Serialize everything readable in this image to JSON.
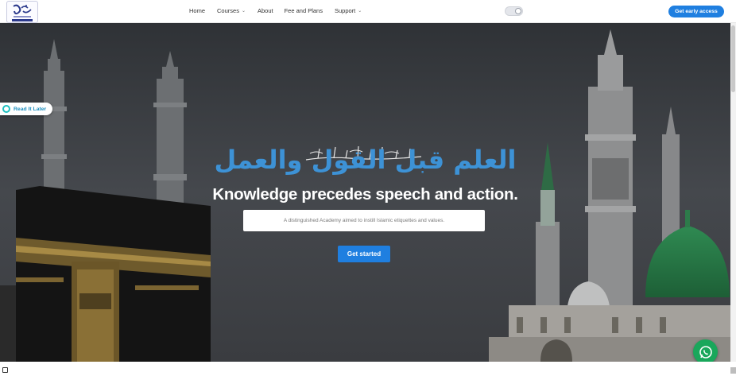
{
  "nav": {
    "links": [
      {
        "label": "Home"
      },
      {
        "label": "Courses",
        "has_caret": true
      },
      {
        "label": "About"
      },
      {
        "label": "Fee and Plans"
      },
      {
        "label": "Support",
        "has_caret": true
      }
    ],
    "theme_toggle": {
      "state": "off"
    },
    "cta_label": "Get early access"
  },
  "hero": {
    "arabic_title": "العلم قبل القول والعمل",
    "headline": "Knowledge precedes speech and action.",
    "subtitle": "A distinguished Academy aimed to instill Islamic etiquettes and values.",
    "button_label": "Get started"
  },
  "widgets": {
    "read_later_label": "Read It Later"
  },
  "colors": {
    "accent": "#1f7fe0",
    "arabic_text": "#3d92d6",
    "whatsapp": "#19a75b",
    "hero_overlay": "#3f4246"
  },
  "icons": [
    "logo-icon",
    "chevron-down-icon",
    "theme-toggle-icon",
    "read-later-icon",
    "whatsapp-icon",
    "bismillah-calligraphy"
  ]
}
